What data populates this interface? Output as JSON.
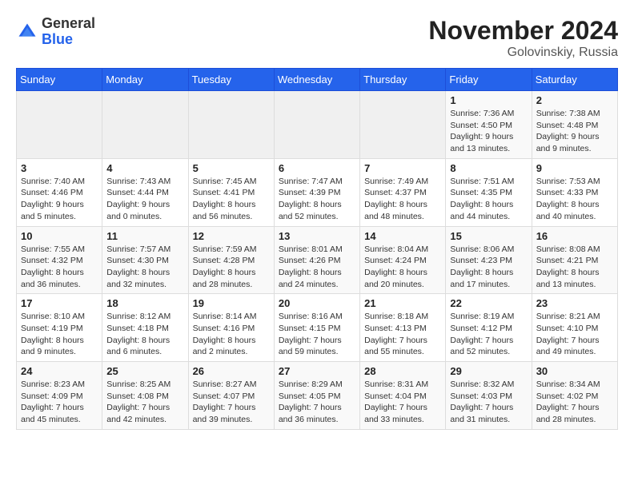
{
  "header": {
    "logo_general": "General",
    "logo_blue": "Blue",
    "month_year": "November 2024",
    "location": "Golovinskiy, Russia"
  },
  "days_of_week": [
    "Sunday",
    "Monday",
    "Tuesday",
    "Wednesday",
    "Thursday",
    "Friday",
    "Saturday"
  ],
  "weeks": [
    [
      {
        "day": "",
        "info": ""
      },
      {
        "day": "",
        "info": ""
      },
      {
        "day": "",
        "info": ""
      },
      {
        "day": "",
        "info": ""
      },
      {
        "day": "",
        "info": ""
      },
      {
        "day": "1",
        "info": "Sunrise: 7:36 AM\nSunset: 4:50 PM\nDaylight: 9 hours and 13 minutes."
      },
      {
        "day": "2",
        "info": "Sunrise: 7:38 AM\nSunset: 4:48 PM\nDaylight: 9 hours and 9 minutes."
      }
    ],
    [
      {
        "day": "3",
        "info": "Sunrise: 7:40 AM\nSunset: 4:46 PM\nDaylight: 9 hours and 5 minutes."
      },
      {
        "day": "4",
        "info": "Sunrise: 7:43 AM\nSunset: 4:44 PM\nDaylight: 9 hours and 0 minutes."
      },
      {
        "day": "5",
        "info": "Sunrise: 7:45 AM\nSunset: 4:41 PM\nDaylight: 8 hours and 56 minutes."
      },
      {
        "day": "6",
        "info": "Sunrise: 7:47 AM\nSunset: 4:39 PM\nDaylight: 8 hours and 52 minutes."
      },
      {
        "day": "7",
        "info": "Sunrise: 7:49 AM\nSunset: 4:37 PM\nDaylight: 8 hours and 48 minutes."
      },
      {
        "day": "8",
        "info": "Sunrise: 7:51 AM\nSunset: 4:35 PM\nDaylight: 8 hours and 44 minutes."
      },
      {
        "day": "9",
        "info": "Sunrise: 7:53 AM\nSunset: 4:33 PM\nDaylight: 8 hours and 40 minutes."
      }
    ],
    [
      {
        "day": "10",
        "info": "Sunrise: 7:55 AM\nSunset: 4:32 PM\nDaylight: 8 hours and 36 minutes."
      },
      {
        "day": "11",
        "info": "Sunrise: 7:57 AM\nSunset: 4:30 PM\nDaylight: 8 hours and 32 minutes."
      },
      {
        "day": "12",
        "info": "Sunrise: 7:59 AM\nSunset: 4:28 PM\nDaylight: 8 hours and 28 minutes."
      },
      {
        "day": "13",
        "info": "Sunrise: 8:01 AM\nSunset: 4:26 PM\nDaylight: 8 hours and 24 minutes."
      },
      {
        "day": "14",
        "info": "Sunrise: 8:04 AM\nSunset: 4:24 PM\nDaylight: 8 hours and 20 minutes."
      },
      {
        "day": "15",
        "info": "Sunrise: 8:06 AM\nSunset: 4:23 PM\nDaylight: 8 hours and 17 minutes."
      },
      {
        "day": "16",
        "info": "Sunrise: 8:08 AM\nSunset: 4:21 PM\nDaylight: 8 hours and 13 minutes."
      }
    ],
    [
      {
        "day": "17",
        "info": "Sunrise: 8:10 AM\nSunset: 4:19 PM\nDaylight: 8 hours and 9 minutes."
      },
      {
        "day": "18",
        "info": "Sunrise: 8:12 AM\nSunset: 4:18 PM\nDaylight: 8 hours and 6 minutes."
      },
      {
        "day": "19",
        "info": "Sunrise: 8:14 AM\nSunset: 4:16 PM\nDaylight: 8 hours and 2 minutes."
      },
      {
        "day": "20",
        "info": "Sunrise: 8:16 AM\nSunset: 4:15 PM\nDaylight: 7 hours and 59 minutes."
      },
      {
        "day": "21",
        "info": "Sunrise: 8:18 AM\nSunset: 4:13 PM\nDaylight: 7 hours and 55 minutes."
      },
      {
        "day": "22",
        "info": "Sunrise: 8:19 AM\nSunset: 4:12 PM\nDaylight: 7 hours and 52 minutes."
      },
      {
        "day": "23",
        "info": "Sunrise: 8:21 AM\nSunset: 4:10 PM\nDaylight: 7 hours and 49 minutes."
      }
    ],
    [
      {
        "day": "24",
        "info": "Sunrise: 8:23 AM\nSunset: 4:09 PM\nDaylight: 7 hours and 45 minutes."
      },
      {
        "day": "25",
        "info": "Sunrise: 8:25 AM\nSunset: 4:08 PM\nDaylight: 7 hours and 42 minutes."
      },
      {
        "day": "26",
        "info": "Sunrise: 8:27 AM\nSunset: 4:07 PM\nDaylight: 7 hours and 39 minutes."
      },
      {
        "day": "27",
        "info": "Sunrise: 8:29 AM\nSunset: 4:05 PM\nDaylight: 7 hours and 36 minutes."
      },
      {
        "day": "28",
        "info": "Sunrise: 8:31 AM\nSunset: 4:04 PM\nDaylight: 7 hours and 33 minutes."
      },
      {
        "day": "29",
        "info": "Sunrise: 8:32 AM\nSunset: 4:03 PM\nDaylight: 7 hours and 31 minutes."
      },
      {
        "day": "30",
        "info": "Sunrise: 8:34 AM\nSunset: 4:02 PM\nDaylight: 7 hours and 28 minutes."
      }
    ]
  ]
}
